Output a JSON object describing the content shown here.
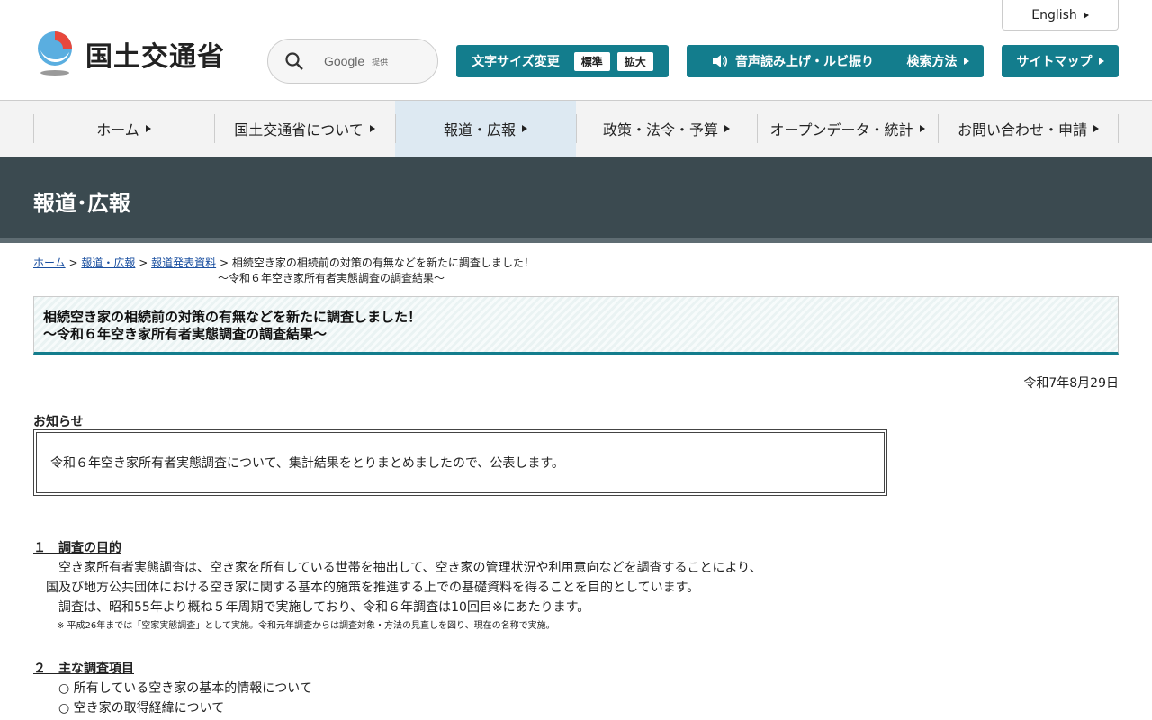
{
  "header": {
    "logo_text": "国土交通省",
    "search": {
      "engine": "Google",
      "provided": "提供"
    },
    "english_label": "English",
    "font_size": {
      "label": "文字サイズ変更",
      "standard": "標準",
      "large": "拡大"
    },
    "voice_label": "音声読み上げ・ルビ振り",
    "search_method_label": "検索方法",
    "sitemap_label": "サイトマップ"
  },
  "nav": {
    "items": [
      {
        "label": "ホーム"
      },
      {
        "label": "国土交通省について"
      },
      {
        "label": "報道・広報"
      },
      {
        "label": "政策・法令・予算"
      },
      {
        "label": "オープンデータ・統計"
      },
      {
        "label": "お問い合わせ・申請"
      }
    ]
  },
  "banner": {
    "title": "報道･広報"
  },
  "breadcrumb": {
    "home": "ホーム",
    "press": "報道・広報",
    "releases": "報道発表資料",
    "sep": ">",
    "current_line1": "相続空き家の相続前の対策の有無などを新たに調査しました！",
    "current_line2": "～令和６年空き家所有者実態調査の調査結果～"
  },
  "title": {
    "line1": "相続空き家の相続前の対策の有無などを新たに調査しました！",
    "line2": "～令和６年空き家所有者実態調査の調査結果～"
  },
  "date": "令和7年8月29日",
  "notice": {
    "label": "お知らせ",
    "text": "令和６年空き家所有者実態調査について、集計結果をとりまとめましたので、公表します。"
  },
  "section1": {
    "heading": "１　調査の目的",
    "line1": "空き家所有者実態調査は、空き家を所有している世帯を抽出して、空き家の管理状況や利用意向などを調査することにより、",
    "line2": "国及び地方公共団体における空き家に関する基本的施策を推進する上での基礎資料を得ることを目的としています。",
    "line3": "調査は、昭和55年より概ね５年周期で実施しており、令和６年調査は10回目※にあたります。",
    "note": "※ 平成26年までは「空家実態調査」として実施。令和元年調査からは調査対象・方法の見直しを図り、現在の名称で実施。"
  },
  "section2": {
    "heading": "２　主な調査項目",
    "items": [
      "○ 所有している空き家の基本的情報について",
      "○ 空き家の取得経緯について"
    ]
  },
  "colors": {
    "accent": "#137d8d",
    "banner": "#3b4a50",
    "link": "#1a4fa0"
  }
}
